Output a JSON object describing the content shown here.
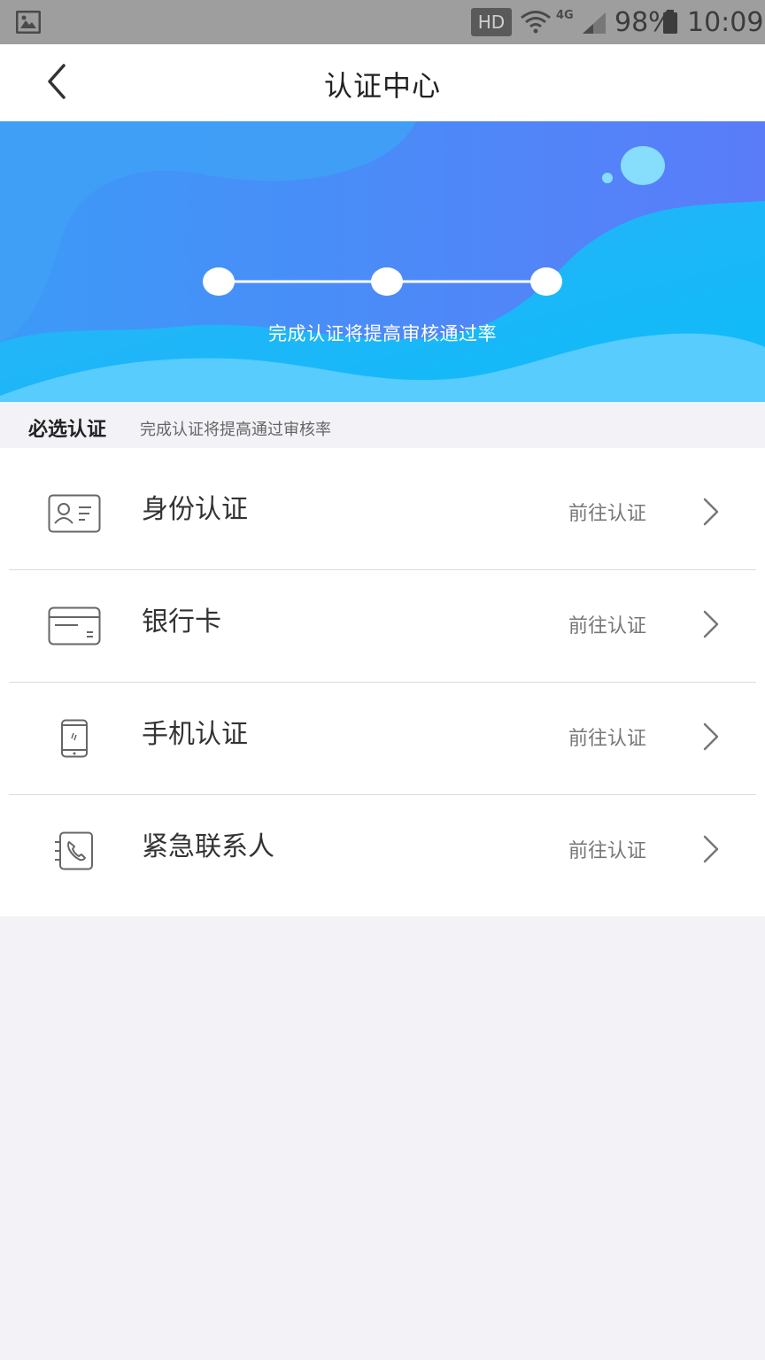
{
  "status_bar": {
    "hd_label": "HD",
    "network_label": "4G",
    "battery_text": "98%",
    "time_text": "10:09"
  },
  "header": {
    "title": "认证中心",
    "back_icon": "chevron-left-icon"
  },
  "banner": {
    "caption": "完成认证将提高审核通过率",
    "steps": 3,
    "colors": {
      "top": "#3f8ff5",
      "accent": "#0fb8f7",
      "light": "#57d0ff"
    }
  },
  "section": {
    "label": "必选认证",
    "subtitle": "完成认证将提高通过审核率"
  },
  "items": [
    {
      "label": "身份认证",
      "action": "前往认证",
      "icon": "id-card-icon"
    },
    {
      "label": "银行卡",
      "action": "前往认证",
      "icon": "bank-card-icon"
    },
    {
      "label": "手机认证",
      "action": "前往认证",
      "icon": "phone-icon"
    },
    {
      "label": "紧急联系人",
      "action": "前往认证",
      "icon": "contact-call-icon"
    }
  ]
}
